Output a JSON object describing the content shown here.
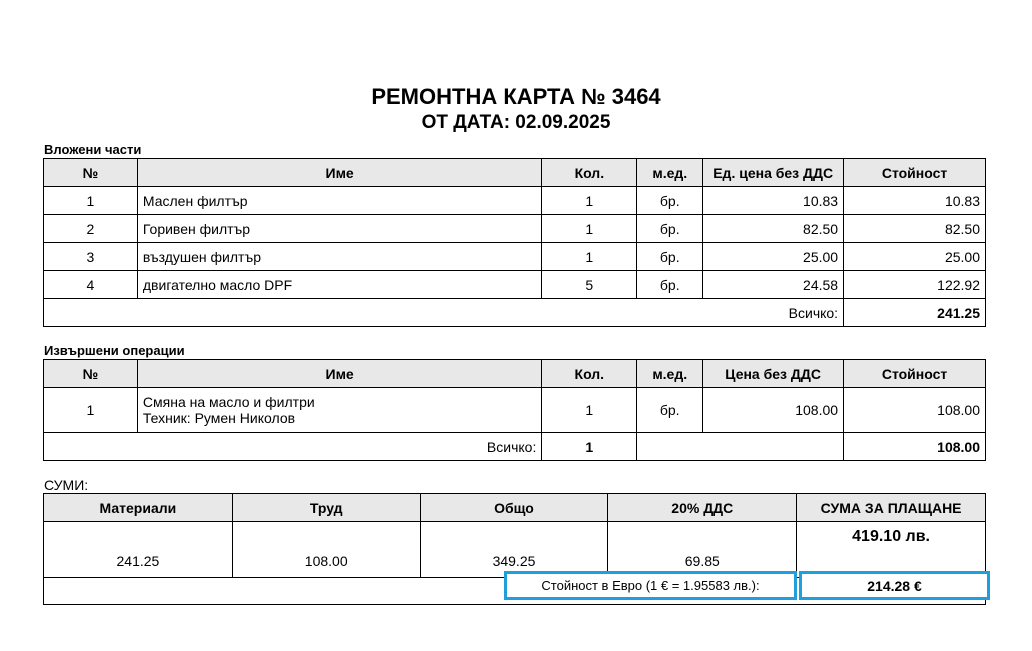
{
  "header": {
    "title": "РЕМОНТНА КАРТА № 3464",
    "date_line": "ОТ ДАТА: 02.09.2025"
  },
  "parts": {
    "section_title": "Вложени части",
    "columns": [
      "№",
      "Име",
      "Кол.",
      "м.ед.",
      "Ед. цена без ДДС",
      "Стойност"
    ],
    "rows": [
      {
        "no": "1",
        "name": "Маслен филтър",
        "qty": "1",
        "unit": "бр.",
        "price": "10.83",
        "value": "10.83"
      },
      {
        "no": "2",
        "name": "Горивен филтър",
        "qty": "1",
        "unit": "бр.",
        "price": "82.50",
        "value": "82.50"
      },
      {
        "no": "3",
        "name": "въздушен филтър",
        "qty": "1",
        "unit": "бр.",
        "price": "25.00",
        "value": "25.00"
      },
      {
        "no": "4",
        "name": "двигателно масло DPF",
        "qty": "5",
        "unit": "бр.",
        "price": "24.58",
        "value": "122.92"
      }
    ],
    "total_label": "Всичко:",
    "total_value": "241.25"
  },
  "operations": {
    "section_title": "Извършени операции",
    "columns": [
      "№",
      "Име",
      "Кол.",
      "м.ед.",
      "Цена без ДДС",
      "Стойност"
    ],
    "rows": [
      {
        "no": "1",
        "name": "Смяна на масло и филтри",
        "technician": "Техник: Румен Николов",
        "qty": "1",
        "unit": "бр.",
        "price": "108.00",
        "value": "108.00"
      }
    ],
    "total_label": "Всичко:",
    "total_qty": "1",
    "total_value": "108.00"
  },
  "sums": {
    "section_title": "СУМИ:",
    "columns": [
      "Материали",
      "Труд",
      "Общо",
      "20% ДДС",
      "СУМА ЗА ПЛАЩАНЕ"
    ],
    "materials": "241.25",
    "labor": "108.00",
    "total": "349.25",
    "vat": "69.85",
    "amount_due": "419.10 лв.",
    "euro_label": "Стойност в Евро (1 € = 1.95583 лв.):",
    "euro_value": "214.28 €"
  },
  "colors": {
    "highlight": "#1fa0dc",
    "header_bg": "#e8e8e8"
  }
}
